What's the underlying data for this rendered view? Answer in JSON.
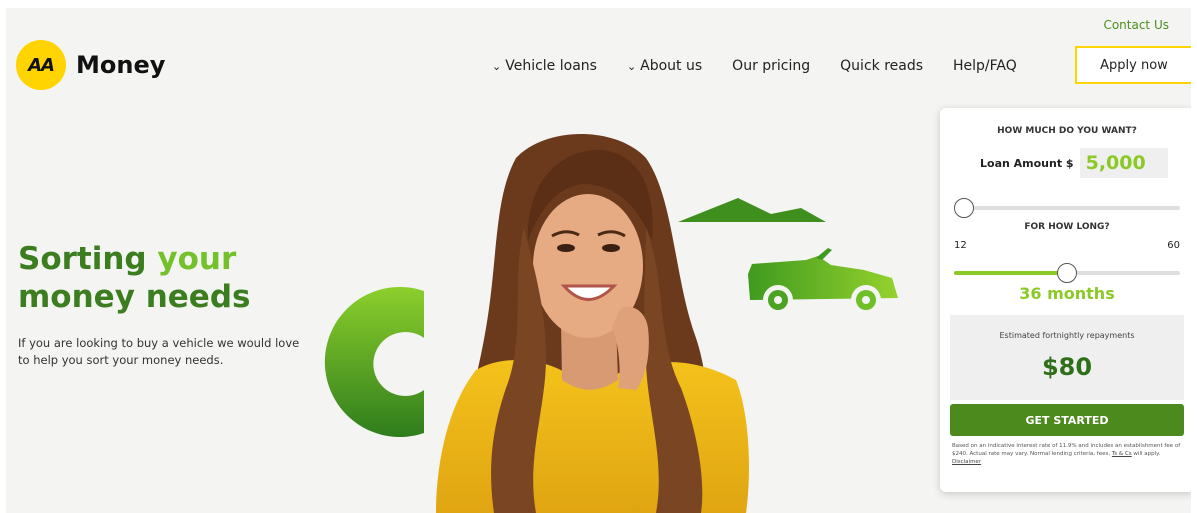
{
  "header": {
    "contact": "Contact Us",
    "logo_badge": "AA",
    "logo_text": "Money",
    "nav": [
      {
        "label": "Vehicle loans",
        "dropdown": true
      },
      {
        "label": "About us",
        "dropdown": true
      },
      {
        "label": "Our pricing",
        "dropdown": false
      },
      {
        "label": "Quick reads",
        "dropdown": false
      },
      {
        "label": "Help/FAQ",
        "dropdown": false
      }
    ],
    "apply": "Apply now"
  },
  "hero": {
    "title_line1_a": "Sorting ",
    "title_line1_b": "your",
    "title_line2": "money needs",
    "subtitle": "If you are looking to buy a vehicle we would love to help you sort your money needs."
  },
  "calculator": {
    "amount_heading": "HOW MUCH DO YOU WANT?",
    "amount_label": "Loan Amount $",
    "amount_value": "5,000",
    "amount_fraction": 0.0,
    "term_heading": "FOR HOW LONG?",
    "term_min": "12",
    "term_max": "60",
    "term_value": 36,
    "term_text": "36 months",
    "estimate_label": "Estimated fortnightly repayments",
    "estimate_value": "$80",
    "cta": "GET STARTED",
    "fineprint": "Based on an indicative interest rate of 11.9% and includes an establishment fee of $240. Actual rate may vary. Normal lending criteria, fees,",
    "tcs_link": "Ts & Cs",
    "fineprint_mid": "will apply.",
    "disclaimer_link": "Disclaimer"
  },
  "colors": {
    "brand_yellow": "#ffd400",
    "dark_green": "#3b7d1f",
    "light_green": "#8ac926",
    "cta_green": "#4d8a1e"
  }
}
